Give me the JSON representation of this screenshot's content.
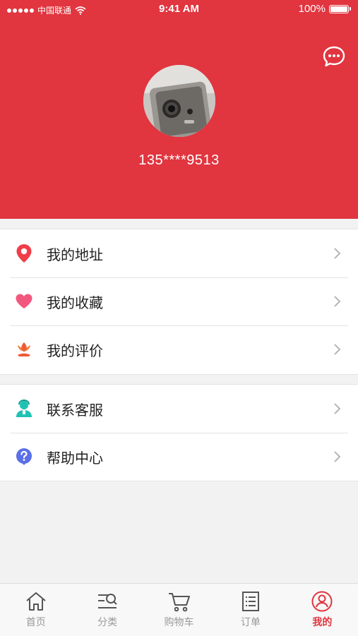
{
  "status_bar": {
    "carrier": "中国联通",
    "time": "9:41 AM",
    "battery": "100%"
  },
  "profile": {
    "phone": "135****9513"
  },
  "menu_group_1": [
    {
      "label": "我的地址",
      "icon": "location-pin-icon"
    },
    {
      "label": "我的收藏",
      "icon": "heart-icon"
    },
    {
      "label": "我的评价",
      "icon": "flower-icon"
    }
  ],
  "menu_group_2": [
    {
      "label": "联系客服",
      "icon": "customer-service-icon"
    },
    {
      "label": "帮助中心",
      "icon": "question-icon"
    }
  ],
  "tabbar": [
    {
      "label": "首页",
      "icon": "home-icon"
    },
    {
      "label": "分类",
      "icon": "category-search-icon"
    },
    {
      "label": "购物车",
      "icon": "cart-icon"
    },
    {
      "label": "订单",
      "icon": "orders-list-icon"
    },
    {
      "label": "我的",
      "icon": "profile-icon",
      "active": true
    }
  ],
  "colors": {
    "brand": "#e1353f",
    "inactive": "#999999",
    "background": "#f2f2f2"
  }
}
